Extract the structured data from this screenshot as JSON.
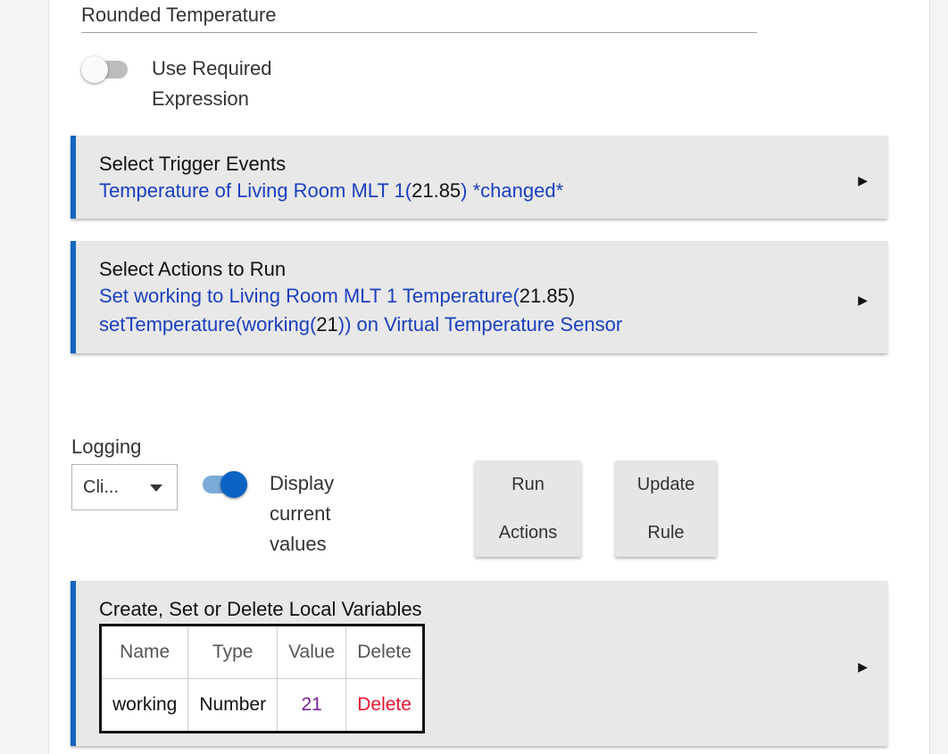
{
  "rule": {
    "name_value": "Rounded Temperature",
    "required_expression_label": [
      "Use Required",
      "Expression"
    ],
    "required_expression_on": false
  },
  "trigger_card": {
    "title": "Select Trigger Events",
    "summary_prefix": "Temperature of Living Room MLT 1(",
    "summary_value": "21.85",
    "summary_suffix": ") *changed*"
  },
  "actions_card": {
    "title": "Select Actions to Run",
    "line1_prefix": "Set working to Living Room MLT 1 Temperature(",
    "line1_value": "21.85",
    "line1_suffix": ")",
    "line2_prefix": "setTemperature(working(",
    "line2_value": "21",
    "line2_suffix": ")) on Virtual Temperature Sensor"
  },
  "logging": {
    "label": "Logging",
    "selected": "Cli..."
  },
  "display_values": {
    "label": [
      "Display",
      "current",
      "values"
    ],
    "on": true
  },
  "buttons": {
    "run_actions": [
      "Run",
      "Actions"
    ],
    "update_rule": [
      "Update",
      "Rule"
    ]
  },
  "variables_card": {
    "title": "Create, Set or Delete Local Variables",
    "headers": [
      "Name",
      "Type",
      "Value",
      "Delete"
    ],
    "rows": [
      {
        "name": "working",
        "type": "Number",
        "value": "21",
        "delete": "Delete"
      }
    ]
  },
  "icons": {
    "card_arrow": "play-arrow-right-icon",
    "select_caret": "caret-down-icon"
  },
  "colors": {
    "accent": "#1565c0",
    "link": "#1a3fbf",
    "value": "#7a1f9a",
    "delete": "#e8112d",
    "toggle_on": "#0b63c4"
  }
}
